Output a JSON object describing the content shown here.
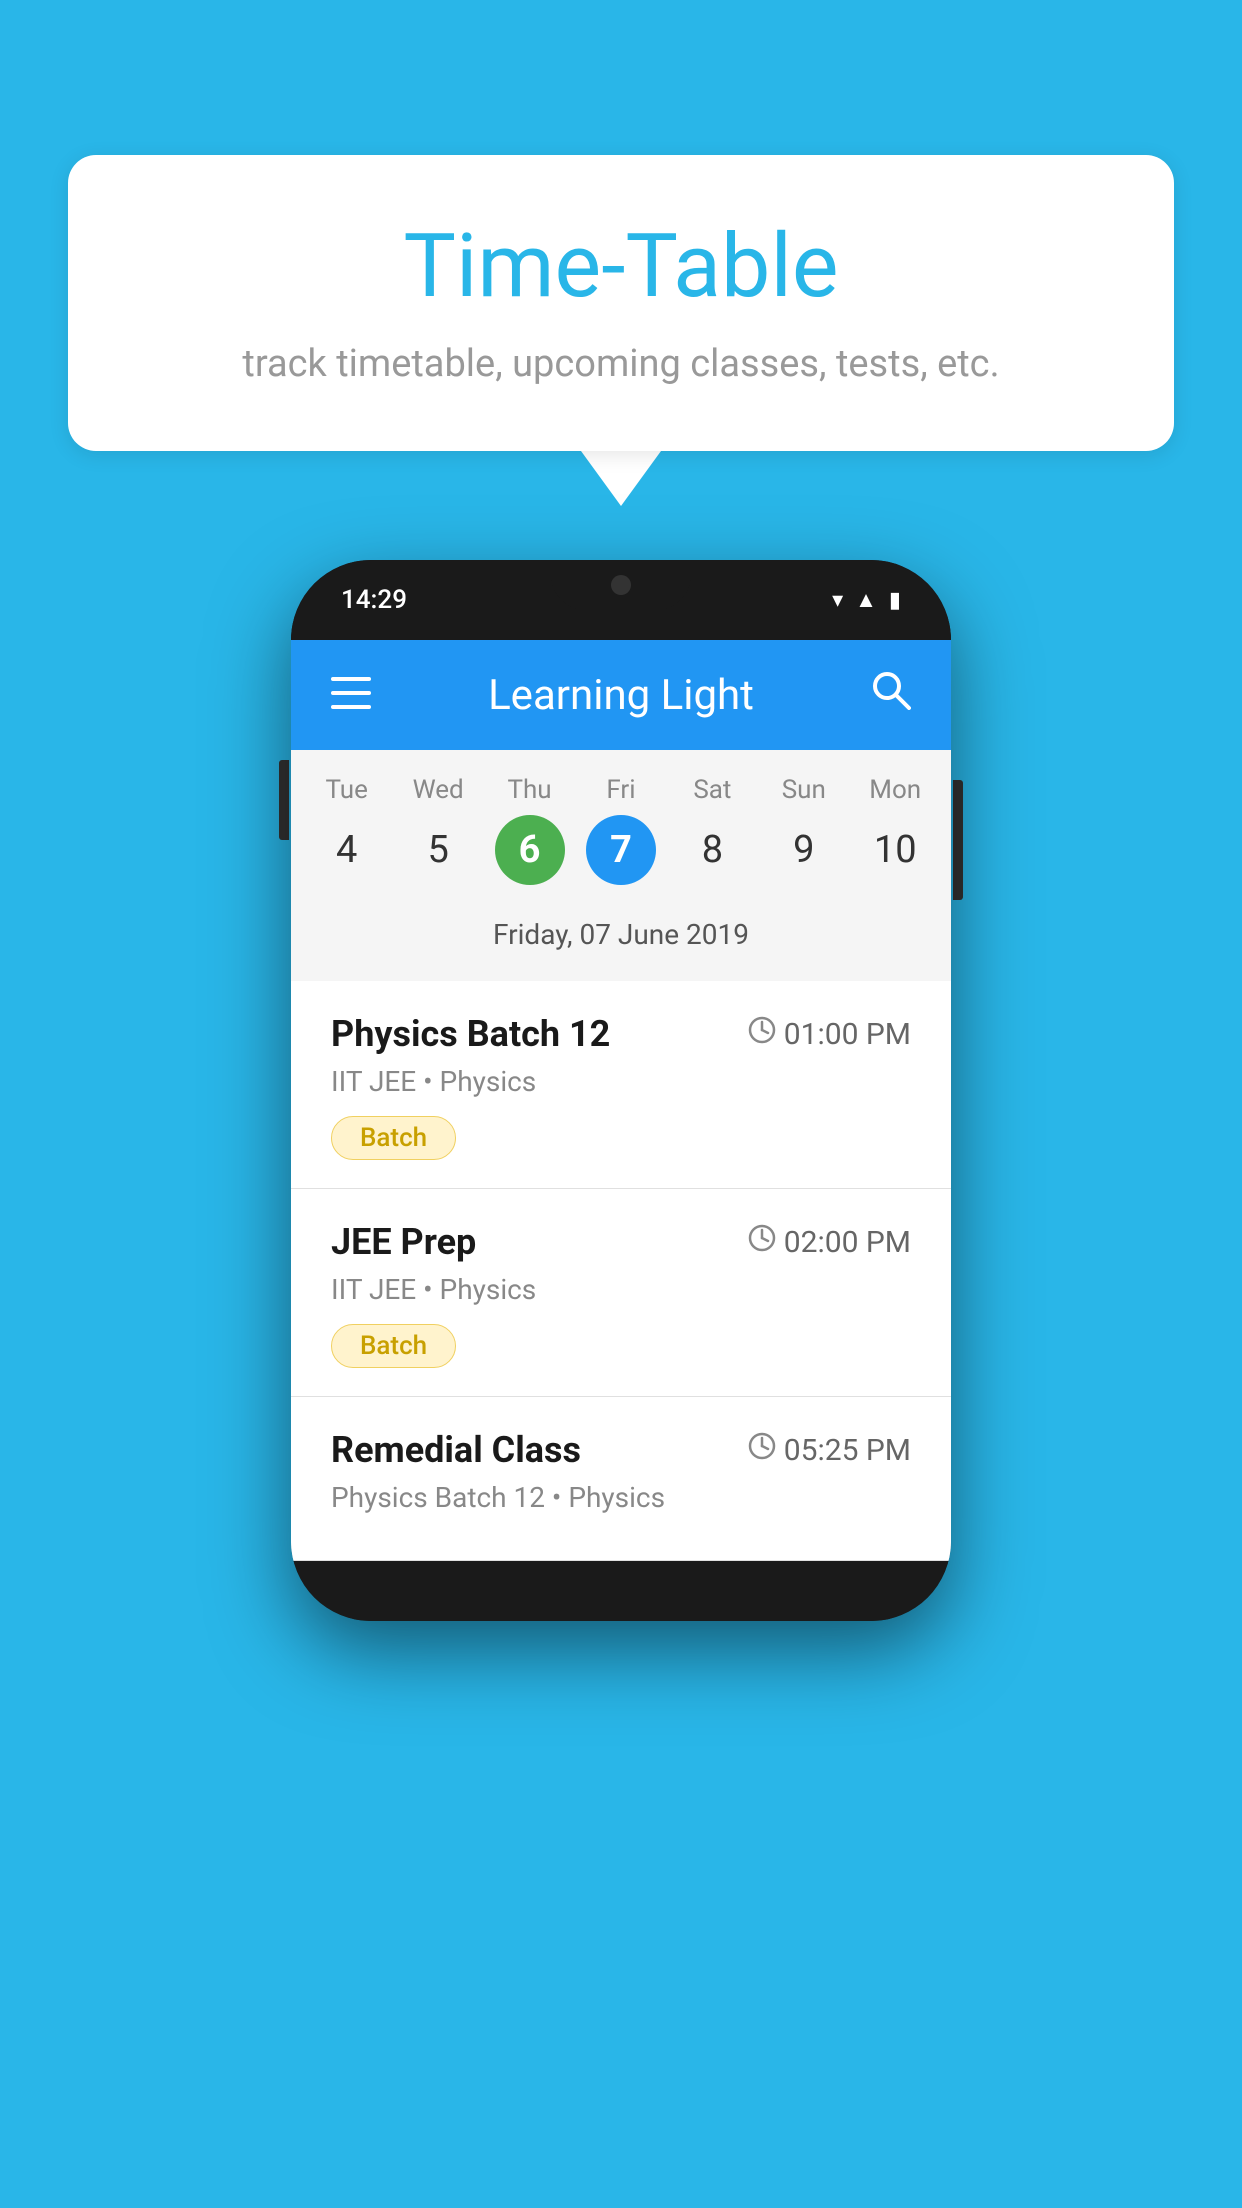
{
  "background_color": "#29B6E8",
  "speech_bubble": {
    "title": "Time-Table",
    "subtitle": "track timetable, upcoming classes, tests, etc."
  },
  "phone": {
    "status_bar": {
      "time": "14:29"
    },
    "app_header": {
      "title": "Learning Light"
    },
    "calendar": {
      "days": [
        {
          "label": "Tue",
          "number": "4",
          "state": "normal"
        },
        {
          "label": "Wed",
          "number": "5",
          "state": "normal"
        },
        {
          "label": "Thu",
          "number": "6",
          "state": "today"
        },
        {
          "label": "Fri",
          "number": "7",
          "state": "selected"
        },
        {
          "label": "Sat",
          "number": "8",
          "state": "normal"
        },
        {
          "label": "Sun",
          "number": "9",
          "state": "normal"
        },
        {
          "label": "Mon",
          "number": "10",
          "state": "normal"
        }
      ],
      "selected_date_label": "Friday, 07 June 2019"
    },
    "schedule_items": [
      {
        "title": "Physics Batch 12",
        "time": "01:00 PM",
        "subtitle": "IIT JEE • Physics",
        "badge": "Batch"
      },
      {
        "title": "JEE Prep",
        "time": "02:00 PM",
        "subtitle": "IIT JEE • Physics",
        "badge": "Batch"
      },
      {
        "title": "Remedial Class",
        "time": "05:25 PM",
        "subtitle": "Physics Batch 12 • Physics",
        "badge": null
      }
    ]
  }
}
